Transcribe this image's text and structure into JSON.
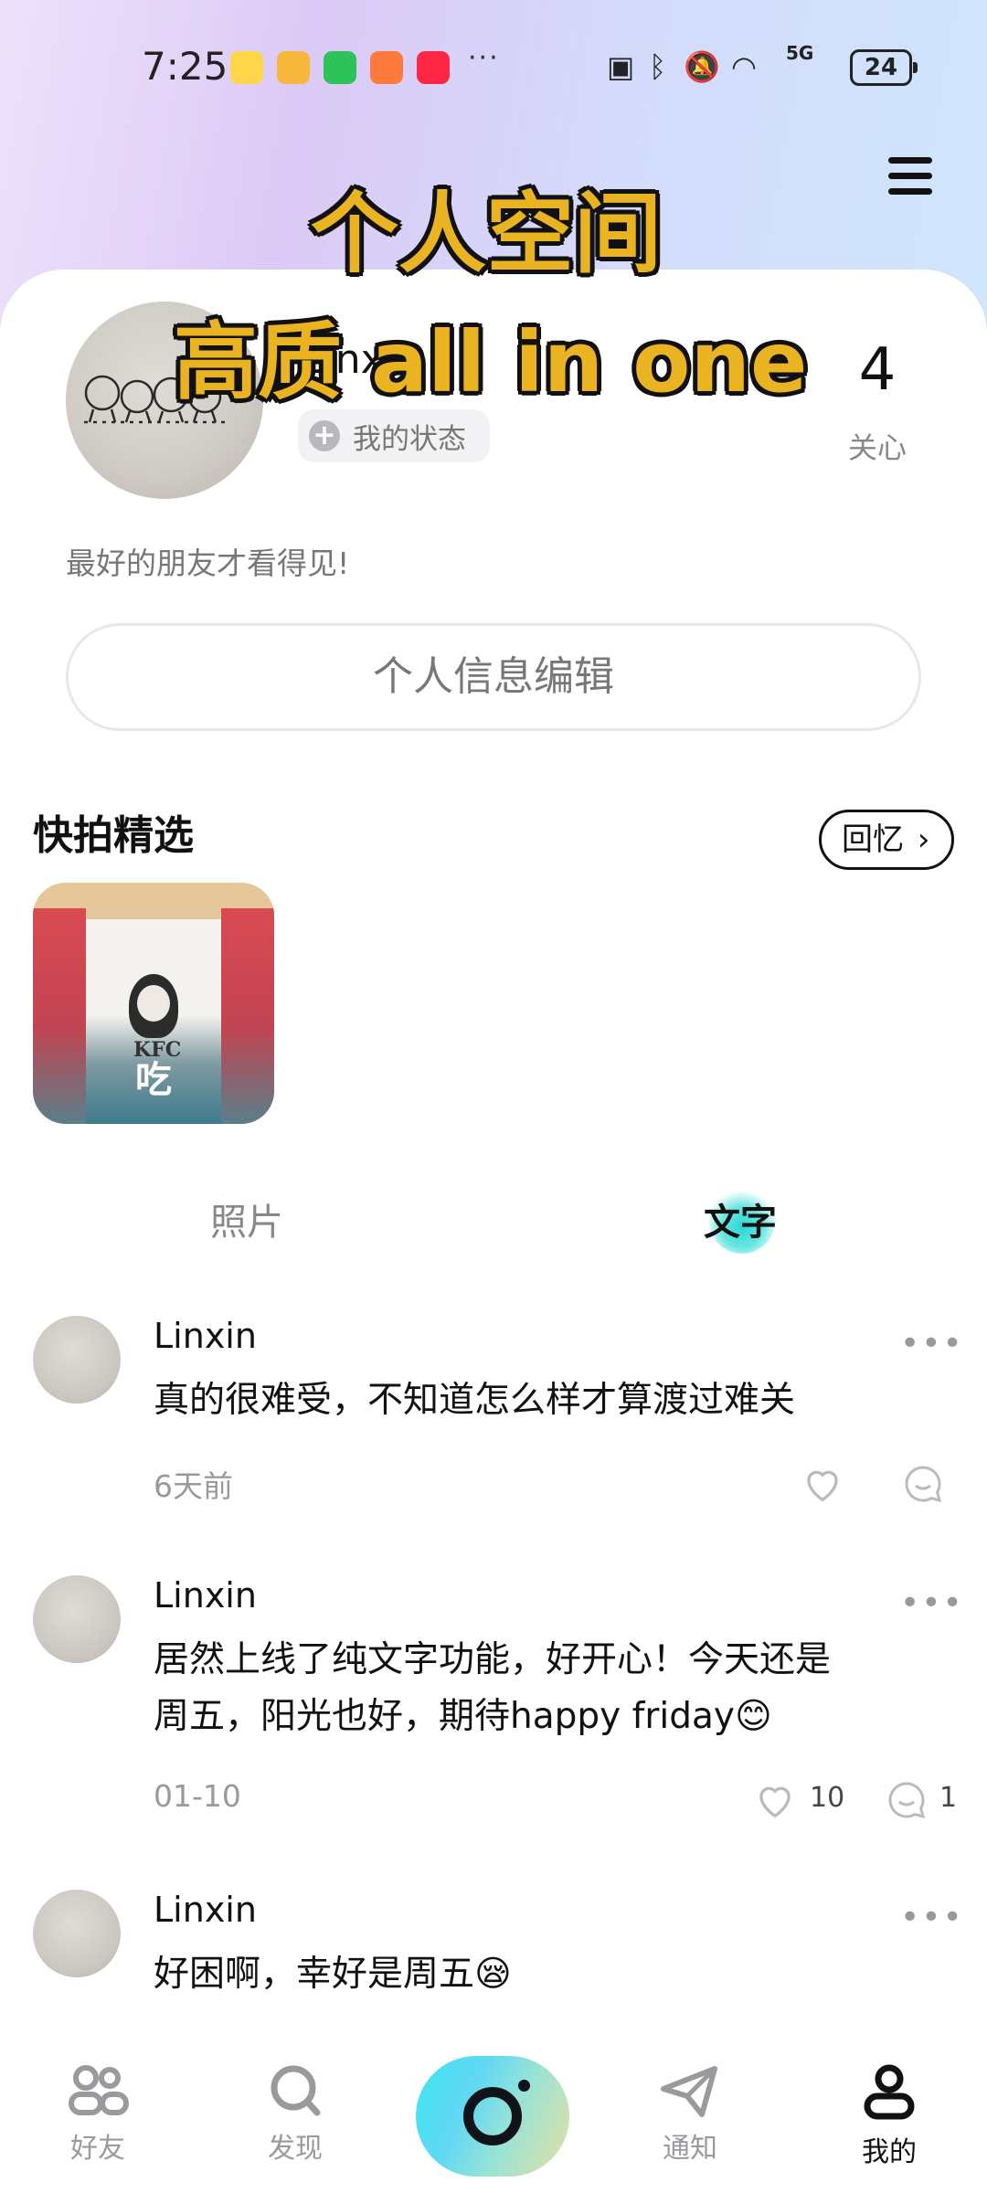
{
  "status_bar": {
    "time": "7:25",
    "more": "···",
    "signal_label": "5G",
    "battery": "24"
  },
  "overlay": {
    "line1": "个人空间",
    "line2": "高质 all   in one"
  },
  "profile": {
    "username": "Linx",
    "status_chip": "我的状态",
    "follow_count": "4",
    "follow_label": "关心",
    "bio": "最好的朋友才看得见!",
    "edit_button": "个人信息编辑"
  },
  "snapshots": {
    "title": "快拍精选",
    "memory_button": "回忆",
    "item_caption": "吃",
    "item_logo_text": "KFC"
  },
  "tabs": {
    "photo": "照片",
    "text": "文字"
  },
  "posts": [
    {
      "author": "Linxin",
      "text": "真的很难受，不知道怎么样才算渡过难关",
      "time": "6天前",
      "likes": "",
      "comments": ""
    },
    {
      "author": "Linxin",
      "text": "居然上线了纯文字功能，好开心！今天还是周五，阳光也好，期待happy friday😊",
      "time": "01-10",
      "likes": "10",
      "comments": "1"
    },
    {
      "author": "Linxin",
      "text": "好困啊，幸好是周五😪",
      "time": "",
      "likes": "",
      "comments": ""
    }
  ],
  "nav": {
    "friends": "好友",
    "discover": "发现",
    "notify": "通知",
    "me": "我的"
  },
  "colors": {
    "overlay_text": "#e9b321",
    "accent_teal": "#28d7d3",
    "muted": "#999999"
  }
}
